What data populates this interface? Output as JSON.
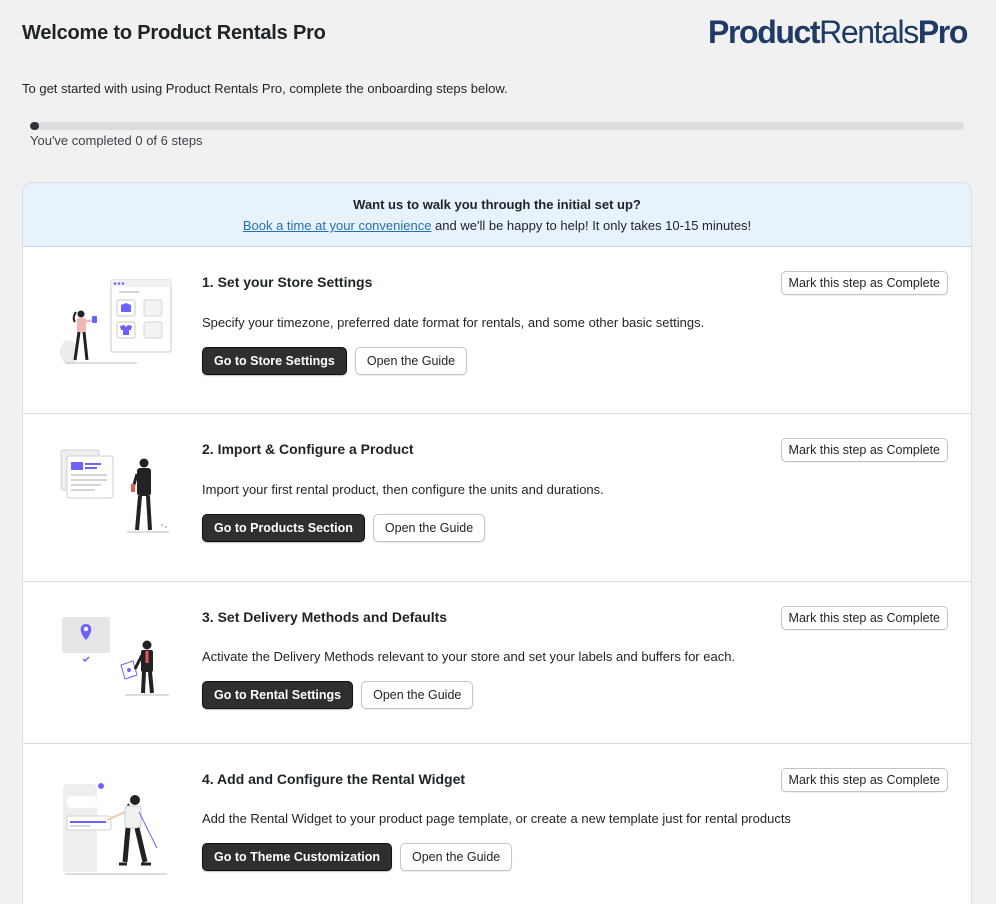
{
  "header": {
    "title": "Welcome to Product Rentals Pro",
    "logo_part1": "Product",
    "logo_part2": "Rentals",
    "logo_part3": "Pro",
    "intro": "To get started with using Product Rentals Pro, complete the onboarding steps below."
  },
  "progress": {
    "text": "You've completed 0 of 6 steps",
    "completed": 0,
    "total": 6
  },
  "banner": {
    "title": "Want us to walk you through the initial set up?",
    "link_text": "Book a time at your convenience",
    "rest_text": " and we'll be happy to help! It only takes 10-15 minutes!"
  },
  "colors": {
    "accent": "#2271b1",
    "logo": "#1f3a64",
    "primary_button": "#2f2f2f",
    "banner_bg": "#e8f2fc",
    "illustration_accent": "#6c63ff"
  },
  "steps": [
    {
      "title": "1. Set your Store Settings",
      "description": "Specify your timezone, preferred date format for rentals, and some other basic settings.",
      "primary_label": "Go to Store Settings",
      "guide_label": "Open the Guide",
      "complete_label": "Mark this step as Complete",
      "illustration": "store-settings-illustration"
    },
    {
      "title": "2. Import & Configure a Product",
      "description": "Import your first rental product, then configure the units and durations.",
      "primary_label": "Go to Products Section",
      "guide_label": "Open the Guide",
      "complete_label": "Mark this step as Complete",
      "illustration": "import-product-illustration"
    },
    {
      "title": "3. Set Delivery Methods and Defaults",
      "description": "Activate the Delivery Methods relevant to your store and set your labels and buffers for each.",
      "primary_label": "Go to Rental Settings",
      "guide_label": "Open the Guide",
      "complete_label": "Mark this step as Complete",
      "illustration": "delivery-methods-illustration"
    },
    {
      "title": "4. Add and Configure the Rental Widget",
      "description": "Add the Rental Widget to your product page template, or create a new template just for rental products",
      "primary_label": "Go to Theme Customization",
      "guide_label": "Open the Guide",
      "complete_label": "Mark this step as Complete",
      "illustration": "rental-widget-illustration"
    }
  ]
}
